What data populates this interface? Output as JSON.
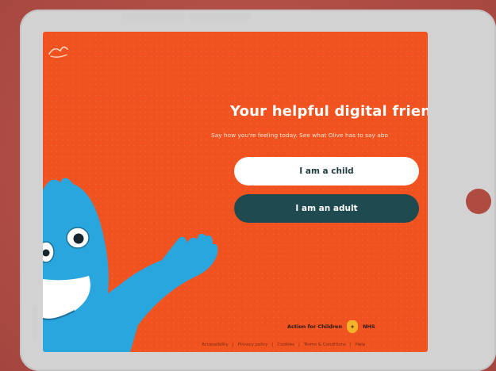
{
  "screen": {
    "headline": "Your helpful digital friend",
    "subline": "Say how you're feeling today. See what Olive has to say abo",
    "buttons": {
      "child_label": "I am a child",
      "adult_label": "I am an adult"
    },
    "partners": {
      "partner1": "Action for Children",
      "partner2_abbrev": "NHS"
    },
    "footer_links": [
      "Accessibility",
      "Privacy policy",
      "Cookies",
      "Terms & Conditions",
      "Help"
    ]
  },
  "colors": {
    "background": "#b5524a",
    "screen": "#f0531f",
    "child_button": "#ffffff",
    "adult_button": "#1f4a50",
    "monster": "#2aa6df"
  }
}
